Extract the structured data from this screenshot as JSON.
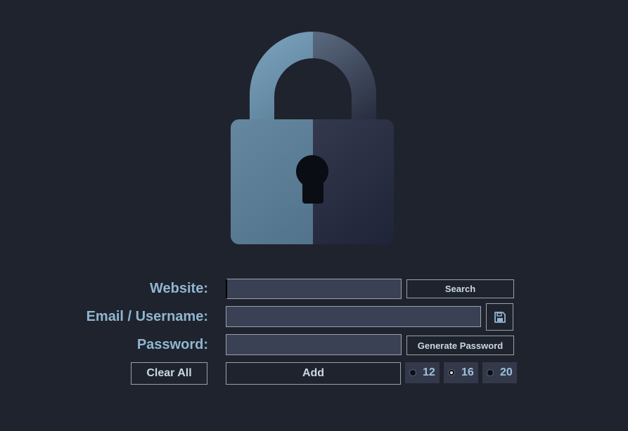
{
  "form": {
    "website_label": "Website:",
    "email_label": "Email / Username:",
    "password_label": "Password:",
    "website_value": "",
    "email_value": "",
    "password_value": ""
  },
  "buttons": {
    "search": "Search",
    "generate_password": "Generate Password",
    "clear_all": "Clear All",
    "add": "Add"
  },
  "password_length": {
    "options": [
      "12",
      "16",
      "20"
    ],
    "selected": "16"
  },
  "icons": {
    "logo": "padlock-icon",
    "save": "floppy-disk-icon"
  },
  "colors": {
    "background": "#1f232d",
    "label": "#8fb6d0",
    "entry_bg": "#3a4155",
    "lock_light": "#5b7f98",
    "lock_dark": "#2b3144"
  }
}
